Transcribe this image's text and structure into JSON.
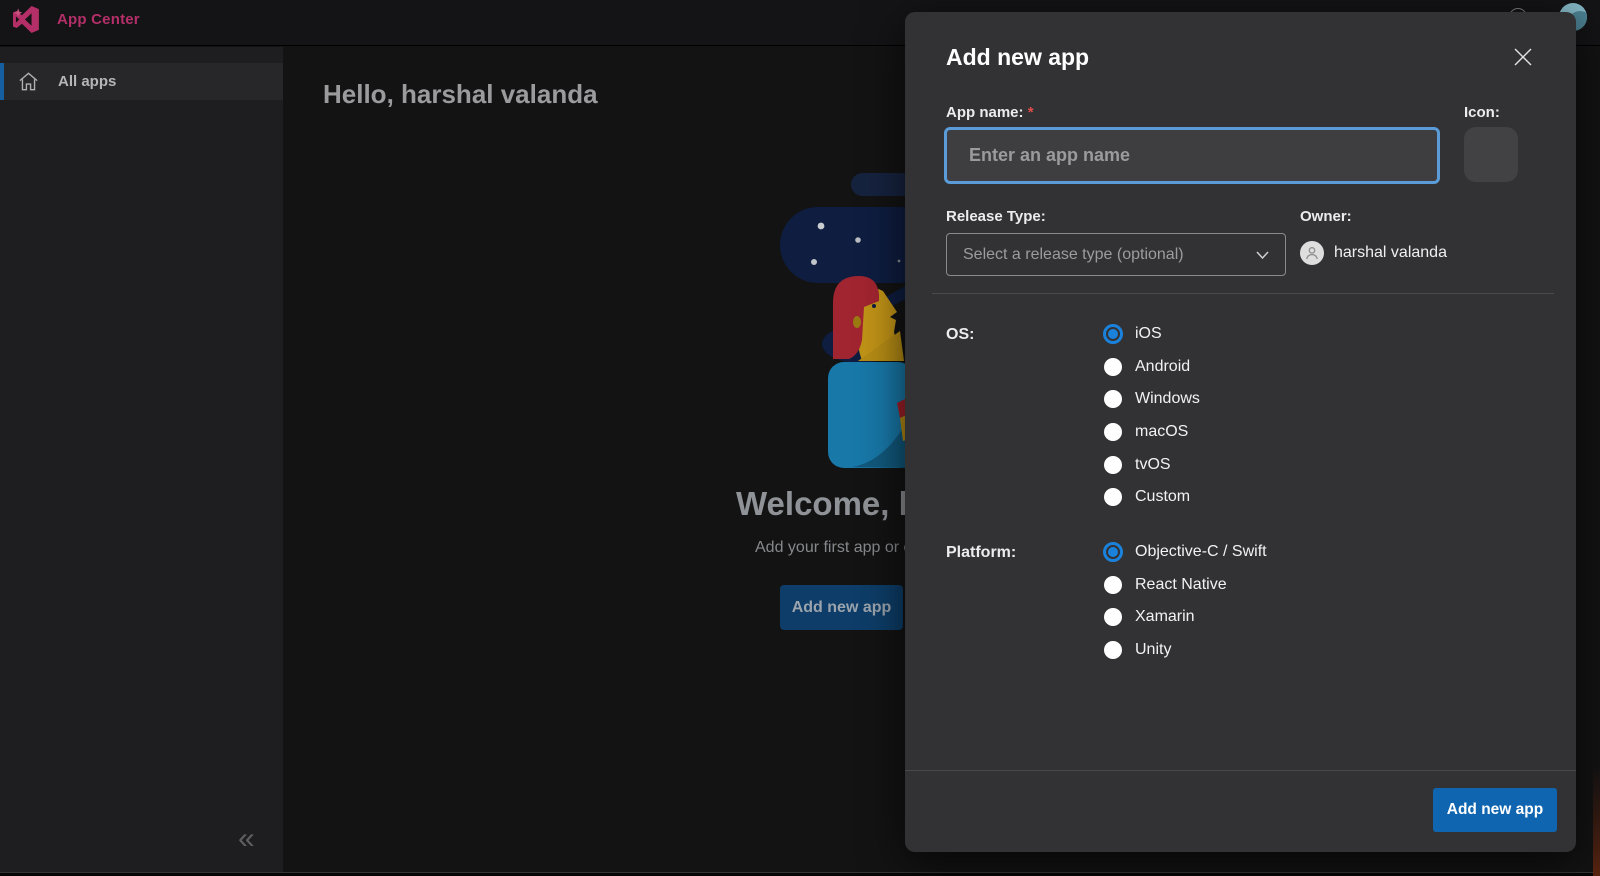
{
  "topbar": {
    "brand": "App Center"
  },
  "sidebar": {
    "items": [
      {
        "label": "All apps",
        "selected": true
      }
    ]
  },
  "main": {
    "greeting": "Hello, harshal valanda",
    "welcome_heading": "Welcome, ha",
    "welcome_subtext": "Add your first app or c",
    "add_button_label": "Add new app"
  },
  "modal": {
    "title": "Add new app",
    "app_name": {
      "label": "App name:",
      "required_mark": "*",
      "placeholder": "Enter an app name",
      "value": ""
    },
    "icon": {
      "label": "Icon:"
    },
    "release_type": {
      "label": "Release Type:",
      "selected_value": "Select a release type (optional)"
    },
    "owner": {
      "label": "Owner:",
      "name": "harshal valanda"
    },
    "os": {
      "label": "OS:",
      "options": [
        {
          "label": "iOS",
          "selected": true
        },
        {
          "label": "Android",
          "selected": false
        },
        {
          "label": "Windows",
          "selected": false
        },
        {
          "label": "macOS",
          "selected": false
        },
        {
          "label": "tvOS",
          "selected": false
        },
        {
          "label": "Custom",
          "selected": false
        }
      ]
    },
    "platform": {
      "label": "Platform:",
      "options": [
        {
          "label": "Objective-C / Swift",
          "selected": true
        },
        {
          "label": "React Native",
          "selected": false
        },
        {
          "label": "Xamarin",
          "selected": false
        },
        {
          "label": "Unity",
          "selected": false
        }
      ]
    },
    "submit_label": "Add new app"
  },
  "colors": {
    "brand_pink": "#b42f68",
    "radio_selected_blue": "#1b82dc",
    "primary_button_blue": "#0f65b0",
    "input_focus_border": "#5b9bd8",
    "required_red": "#e14b4b",
    "modal_background": "#323234"
  }
}
